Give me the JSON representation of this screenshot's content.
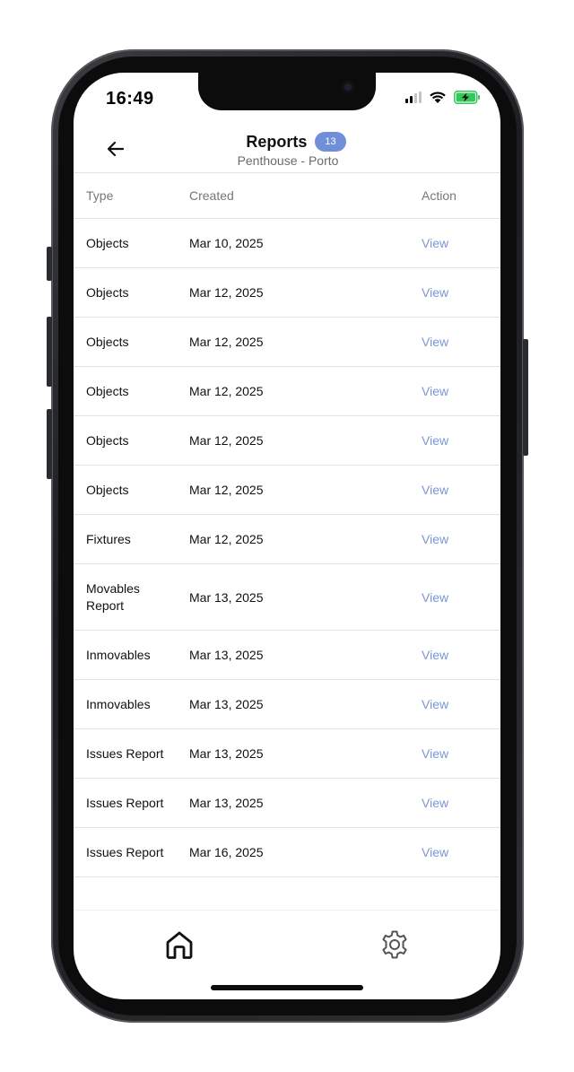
{
  "status_bar": {
    "time": "16:49"
  },
  "header": {
    "title": "Reports",
    "count_badge": "13",
    "subtitle": "Penthouse - Porto"
  },
  "table": {
    "columns": [
      "Type",
      "Created",
      "Action"
    ],
    "rows": [
      {
        "type": "Objects",
        "created": "Mar 10, 2025",
        "action": "View"
      },
      {
        "type": "Objects",
        "created": "Mar 12, 2025",
        "action": "View"
      },
      {
        "type": "Objects",
        "created": "Mar 12, 2025",
        "action": "View"
      },
      {
        "type": "Objects",
        "created": "Mar 12, 2025",
        "action": "View"
      },
      {
        "type": "Objects",
        "created": "Mar 12, 2025",
        "action": "View"
      },
      {
        "type": "Objects",
        "created": "Mar 12, 2025",
        "action": "View"
      },
      {
        "type": "Fixtures",
        "created": "Mar 12, 2025",
        "action": "View"
      },
      {
        "type": "Movables Report",
        "created": "Mar 13, 2025",
        "action": "View"
      },
      {
        "type": "Inmovables",
        "created": "Mar 13, 2025",
        "action": "View"
      },
      {
        "type": "Inmovables",
        "created": "Mar 13, 2025",
        "action": "View"
      },
      {
        "type": "Issues Report",
        "created": "Mar 13, 2025",
        "action": "View"
      },
      {
        "type": "Issues Report",
        "created": "Mar 13, 2025",
        "action": "View"
      },
      {
        "type": "Issues Report",
        "created": "Mar 16, 2025",
        "action": "View"
      }
    ]
  },
  "tab_bar": {
    "items": [
      {
        "icon": "home-icon"
      },
      {
        "icon": "gear-icon"
      }
    ]
  },
  "colors": {
    "accent": "#7b96d3",
    "badge": "#6f8fd9",
    "divider": "#e3e3e3"
  }
}
